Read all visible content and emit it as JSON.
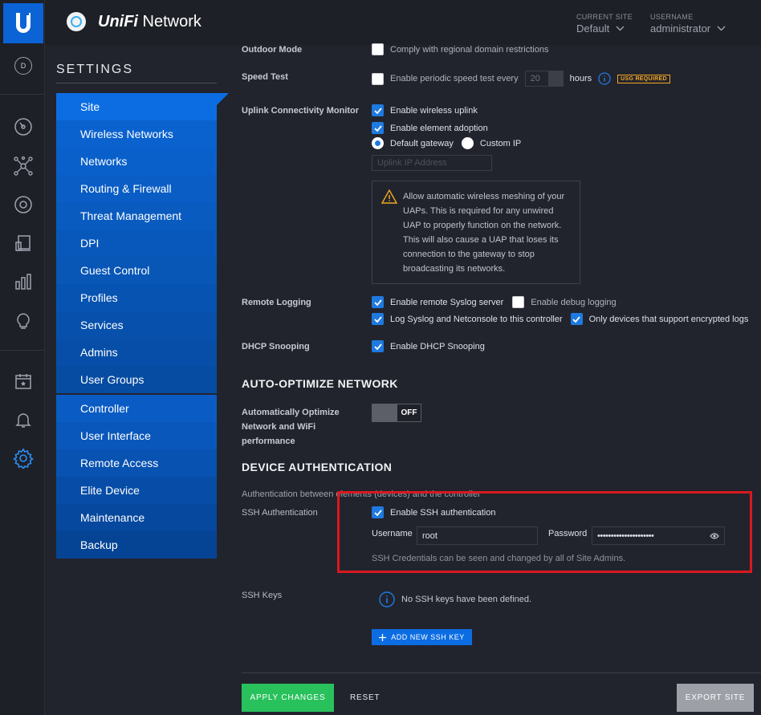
{
  "app": {
    "brand_bold": "UniFi",
    "brand_rest": " Network",
    "site_caption": "CURRENT SITE",
    "site_value": "Default",
    "user_caption": "USERNAME",
    "user_value": "administrator",
    "rail_avatar_letter": "D"
  },
  "rail": {
    "icons": [
      "dashboard-icon",
      "statistics-icon",
      "topology-icon",
      "devices-icon",
      "clients-icon",
      "insights-icon",
      "alerts-icon",
      "events-icon",
      "notifications-icon",
      "settings-icon"
    ]
  },
  "settings": {
    "title": "SETTINGS",
    "items": [
      "Site",
      "Wireless Networks",
      "Networks",
      "Routing & Firewall",
      "Threat Management",
      "DPI",
      "Guest Control",
      "Profiles",
      "Services",
      "Admins",
      "User Groups"
    ],
    "items2": [
      "Controller",
      "User Interface",
      "Remote Access",
      "Elite Device",
      "Maintenance",
      "Backup"
    ]
  },
  "form": {
    "outdoor_label": "Outdoor Mode",
    "outdoor_option": "Comply with regional domain restrictions",
    "speed_label": "Speed Test",
    "speed_option": "Enable periodic speed test every",
    "speed_value": "20",
    "speed_unit": "hours",
    "usg_badge": "USG REQUIRED",
    "uplink_label": "Uplink Connectivity Monitor",
    "uplink_wireless": "Enable wireless uplink",
    "uplink_adoption": "Enable element adoption",
    "uplink_gateway": "Default gateway",
    "uplink_custom": "Custom IP",
    "uplink_ip_placeholder": "Uplink IP Address",
    "warning_text": "Allow automatic wireless meshing of your UAPs. This is required for any unwired UAP to properly function on the network. This will also cause a UAP that loses its connection to the gateway to stop broadcasting its networks.",
    "logging_label": "Remote Logging",
    "logging_syslog": "Enable remote Syslog server",
    "logging_debug": "Enable debug logging",
    "logging_netconsole": "Log Syslog and Netconsole to this controller",
    "logging_encrypted": "Only devices that support encrypted logs",
    "dhcp_label": "DHCP Snooping",
    "dhcp_option": "Enable DHCP Snooping",
    "auto_heading": "AUTO-OPTIMIZE NETWORK",
    "auto_label": "Automatically Optimize Network and WiFi performance",
    "auto_toggle": "OFF",
    "auth_heading": "DEVICE AUTHENTICATION",
    "auth_sub": "Authentication between elements (devices) and the controller",
    "ssh_label": "SSH Authentication",
    "ssh_enable": "Enable SSH authentication",
    "ssh_username_label": "Username",
    "ssh_username_value": "root",
    "ssh_password_label": "Password",
    "ssh_password_value": "•••••••••••••••••••••",
    "ssh_note": "SSH Credentials can be seen and changed by all of Site Admins.",
    "keys_label": "SSH Keys",
    "keys_empty": "No SSH keys have been defined.",
    "add_key": "ADD NEW SSH KEY"
  },
  "footer": {
    "apply": "APPLY CHANGES",
    "reset": "RESET",
    "export": "EXPORT SITE"
  },
  "colors": {
    "accent": "#0c6de3",
    "apply": "#29c15c",
    "highlight": "#d8191f",
    "warning": "#f5a623"
  }
}
